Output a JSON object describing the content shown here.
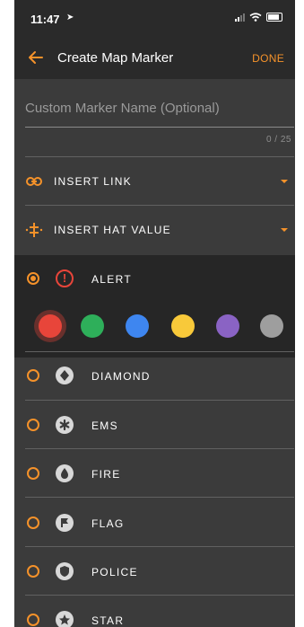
{
  "status": {
    "time": "11:47"
  },
  "navbar": {
    "title": "Create Map Marker",
    "done_label": "DONE"
  },
  "name_field": {
    "placeholder": "Custom Marker Name (Optional)",
    "counter": "0 / 25"
  },
  "insert_link": {
    "label": "INSERT LINK"
  },
  "insert_hat": {
    "label": "INSERT HAT VALUE"
  },
  "markers": [
    {
      "label": "ALERT",
      "selected": true,
      "icon": "alert-icon"
    },
    {
      "label": "DIAMOND",
      "selected": false,
      "icon": "diamond-icon"
    },
    {
      "label": "EMS",
      "selected": false,
      "icon": "ems-icon"
    },
    {
      "label": "FIRE",
      "selected": false,
      "icon": "fire-icon"
    },
    {
      "label": "FLAG",
      "selected": false,
      "icon": "flag-icon"
    },
    {
      "label": "POLICE",
      "selected": false,
      "icon": "police-icon"
    },
    {
      "label": "STAR",
      "selected": false,
      "icon": "star-icon"
    }
  ],
  "colors": [
    {
      "name": "red",
      "hex": "#e8453a",
      "selected": true
    },
    {
      "name": "green",
      "hex": "#2eaf5a"
    },
    {
      "name": "blue",
      "hex": "#3e86f0"
    },
    {
      "name": "yellow",
      "hex": "#f8c93a"
    },
    {
      "name": "purple",
      "hex": "#8a63c4"
    },
    {
      "name": "gray",
      "hex": "#9e9e9e"
    }
  ],
  "theme": {
    "accent": "#f5922a",
    "background": "#3b3b3b",
    "bar": "#2a2a2a"
  }
}
